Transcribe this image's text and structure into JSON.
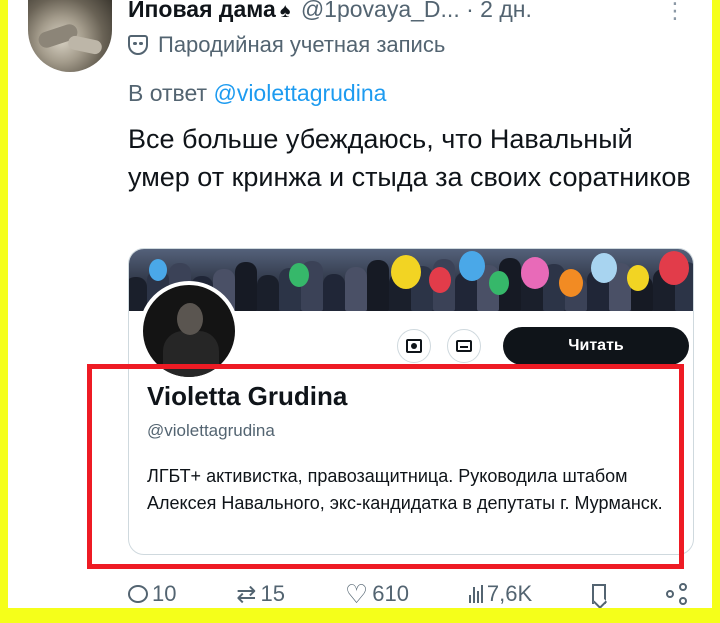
{
  "tweet": {
    "author_name": "Иповая дама",
    "author_handle": "@1povaya_D...",
    "dot": "·",
    "time": "2 дн.",
    "more": "⋮",
    "parody_label": "Пародийная учетная запись",
    "reply_prefix": "В ответ",
    "reply_mention": "@violettagrudina",
    "text": "Все больше убеждаюсь, что Навальный умер от кринжа и стыда за своих соратников"
  },
  "embed": {
    "follow_label": "Читать",
    "name": "Violetta Grudina",
    "handle": "@violettagrudina",
    "bio": "ЛГБТ+ активистка, правозащитница. Руководила штабом Алексея Навального, экс-кандидатка в депутаты г. Мурманск.",
    "balloon_colors": [
      "#f2d423",
      "#e23c4a",
      "#4aa8e8",
      "#36b86a",
      "#e86ab8",
      "#f28b23",
      "#a8d4f0"
    ]
  },
  "actions": {
    "replies": "10",
    "retweets": "15",
    "likes": "610",
    "views": "7,6K"
  },
  "icons": [
    "mask-icon",
    "spade-icon",
    "more-icon",
    "subscribe-icon",
    "message-icon",
    "reply-icon",
    "retweet-icon",
    "like-icon",
    "views-icon",
    "bookmark-icon",
    "share-icon"
  ],
  "colors": {
    "background": "#f5ff1a",
    "highlight": "#ee1b24",
    "link": "#1d9bf0",
    "muted": "#536471",
    "text": "#0f1419"
  }
}
